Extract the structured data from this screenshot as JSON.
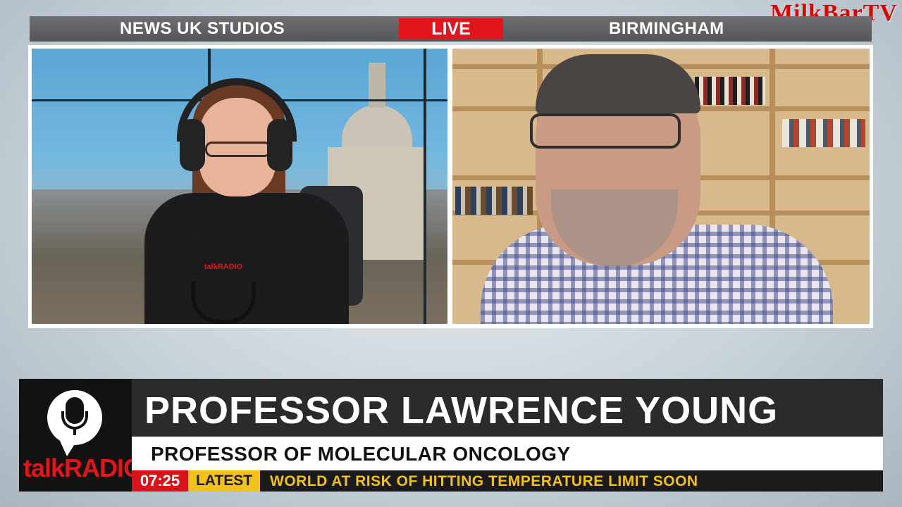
{
  "watermark": "MilkBarTV",
  "top_bar": {
    "left_label": "NEWS UK STUDIOS",
    "live_label": "LIVE",
    "right_label": "BIRMINGHAM"
  },
  "mic_brand": "talkRADIO",
  "lower_third": {
    "logo_text": "talkRADIO",
    "name": "PROFESSOR LAWRENCE YOUNG",
    "title": "PROFESSOR OF MOLECULAR ONCOLOGY"
  },
  "ticker": {
    "time": "07:25",
    "tag": "LATEST",
    "headline": "WORLD AT RISK OF HITTING TEMPERATURE LIMIT SOON"
  },
  "colors": {
    "live_red": "#e3141b",
    "ticker_yellow": "#f3c21a",
    "bar_dark": "#2a2b2d"
  }
}
